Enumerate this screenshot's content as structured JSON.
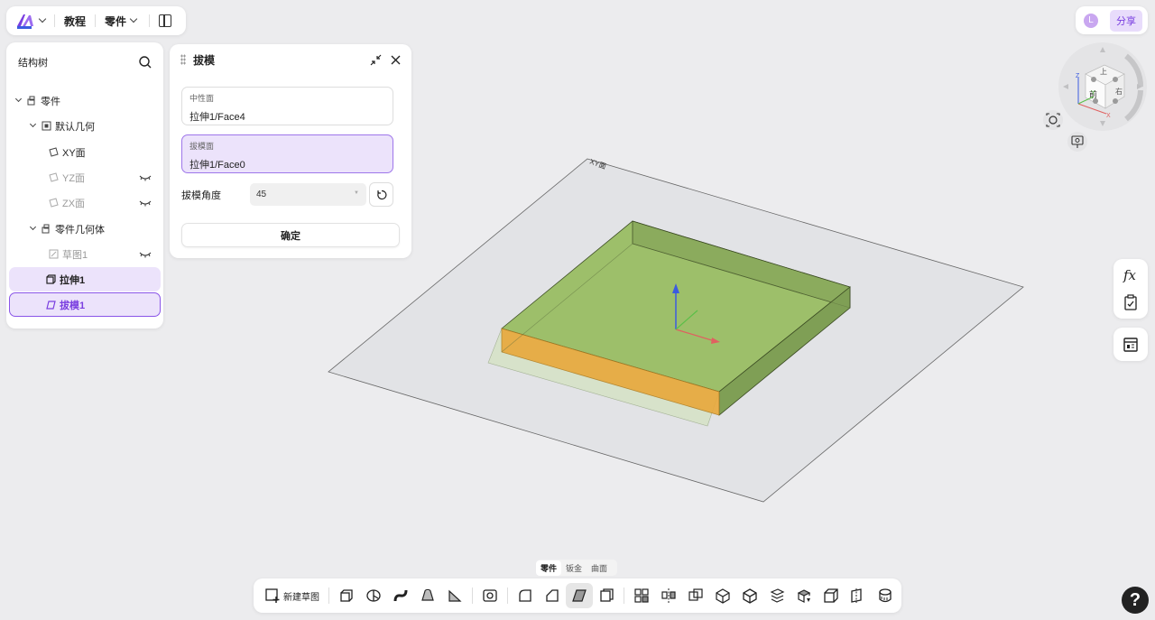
{
  "topbar": {
    "tutorial_label": "教程",
    "part_menu_label": "零件"
  },
  "topright": {
    "avatar_letter": "L",
    "share_label": "分享"
  },
  "tree": {
    "title": "结构树",
    "items": [
      {
        "label": "零件"
      },
      {
        "label": "默认几何"
      },
      {
        "label": "XY面"
      },
      {
        "label": "YZ面"
      },
      {
        "label": "ZX面"
      },
      {
        "label": "零件几何体"
      },
      {
        "label": "草图1"
      },
      {
        "label": "拉伸1"
      },
      {
        "label": "拔模1"
      }
    ]
  },
  "draft": {
    "title": "拔模",
    "neutral_label": "中性面",
    "neutral_value": "拉伸1/Face4",
    "draft_face_label": "拔模面",
    "draft_face_value": "拉伸1/Face0",
    "angle_label": "拔模角度",
    "angle_value": "45",
    "ok_label": "确定"
  },
  "viewport": {
    "plane_label": "XY面",
    "viewcube": {
      "front": "前",
      "right": "右",
      "top": "上"
    },
    "axes": {
      "x": "X",
      "y": "Y",
      "z": "Z"
    },
    "colors": {
      "body_top": "#9dbf6a",
      "body_edge": "#3a4a22",
      "selected_face": "#e8a83a",
      "plane": "#dcdde0"
    }
  },
  "bottom_tabs": [
    "零件",
    "钣金",
    "曲面"
  ],
  "toolbar": {
    "new_sketch_label": "新建草图",
    "tools": [
      "extrude-icon",
      "revolve-icon",
      "sweep-icon",
      "loft-icon",
      "rib-icon",
      "hole-icon",
      "fillet-icon",
      "chamfer-icon",
      "draft-icon",
      "shell-icon",
      "pattern-icon",
      "mirror-icon",
      "combine-icon",
      "split-icon",
      "move-body-icon",
      "delete-body-icon",
      "replace-face-icon",
      "thicken-icon",
      "reference-geometry-icon",
      "measure-icon"
    ]
  },
  "help_label": "?"
}
